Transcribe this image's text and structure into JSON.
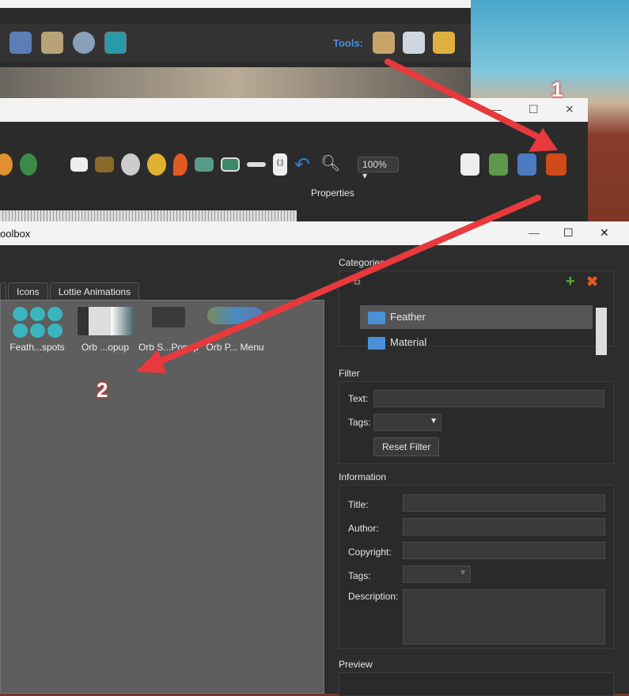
{
  "top_window": {
    "tools_label": "Tools:"
  },
  "editor_window": {
    "zoom": "100%",
    "properties_label": "Properties"
  },
  "toolbox": {
    "title": "oolbox",
    "tabs": [
      "Icons",
      "Lottie Animations"
    ],
    "items": [
      "Feath...spots",
      "Orb ...opup",
      "Orb S...Popup",
      "Orb P... Menu"
    ],
    "categories_label": "Categories",
    "categories": [
      "Feather",
      "Material"
    ],
    "filter": {
      "label": "Filter",
      "text_label": "Text:",
      "text_value": "",
      "tags_label": "Tags:",
      "reset_button": "Reset Filter"
    },
    "information": {
      "label": "Information",
      "title_label": "Title:",
      "author_label": "Author:",
      "copyright_label": "Copyright:",
      "tags_label": "Tags:",
      "description_label": "Description:"
    },
    "preview_label": "Preview"
  },
  "annotations": [
    "1",
    "2"
  ],
  "colors": {
    "arrow": "#e8393d",
    "accent_blue": "#4a8fe0",
    "teal": "#3ab5c0"
  }
}
